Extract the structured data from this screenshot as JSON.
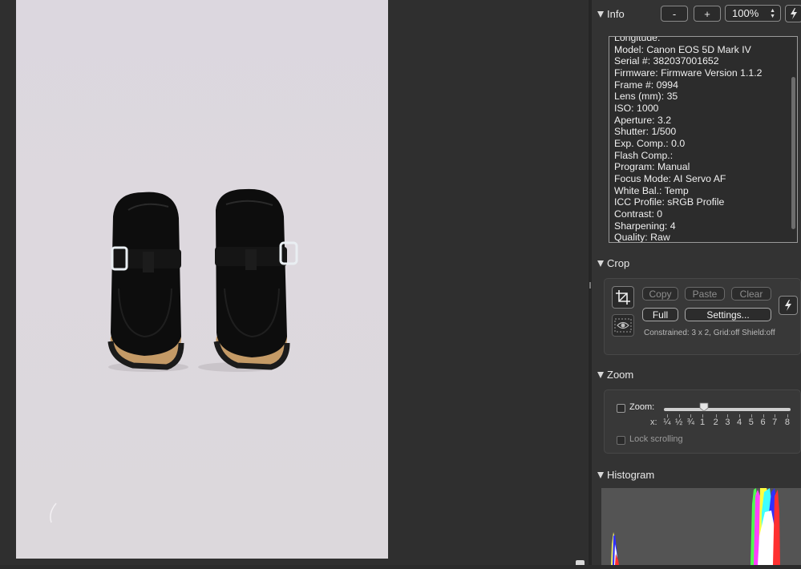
{
  "info": {
    "title": "Info",
    "zoom_out_label": "-",
    "zoom_in_label": "+",
    "zoom_value": "100%",
    "lines": [
      "Longitude:",
      "Model: Canon EOS 5D Mark IV",
      "Serial #: 382037001652",
      "Firmware: Firmware Version 1.1.2",
      "Frame #: 0994",
      "Lens (mm): 35",
      "ISO: 1000",
      "Aperture: 3.2",
      "Shutter: 1/500",
      "Exp. Comp.: 0.0",
      "Flash Comp.:",
      "Program: Manual",
      "Focus Mode: AI Servo AF",
      "White Bal.: Temp",
      "ICC Profile: sRGB Profile",
      "Contrast: 0",
      "Sharpening: 4",
      "Quality: Raw"
    ]
  },
  "crop": {
    "title": "Crop",
    "copy_label": "Copy",
    "paste_label": "Paste",
    "clear_label": "Clear",
    "full_label": "Full",
    "settings_label": "Settings...",
    "status": "Constrained: 3 x 2, Grid:off Shield:off"
  },
  "zoom": {
    "title": "Zoom",
    "checkbox_label": "Zoom:",
    "x_label": "x:",
    "ticks": [
      "¼",
      "½",
      "¾",
      "1",
      "2",
      "3",
      "4",
      "5",
      "6",
      "7",
      "8"
    ],
    "lock_label": "Lock scrolling",
    "slider_value": "1"
  },
  "histogram": {
    "title": "Histogram"
  },
  "icons": {
    "bolt": "bolt-icon",
    "crop": "crop-icon",
    "eye": "eye-icon"
  }
}
